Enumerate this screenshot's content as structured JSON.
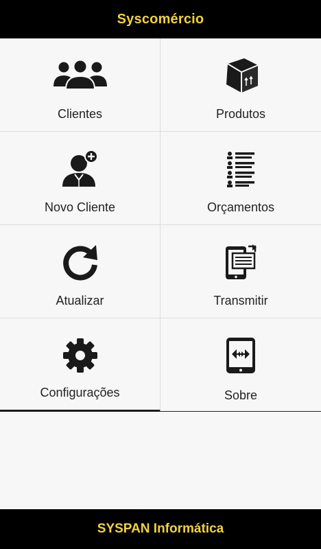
{
  "app": {
    "title": "Syscomércio"
  },
  "menu": [
    {
      "label": "Clientes",
      "icon": "clients-icon"
    },
    {
      "label": "Produtos",
      "icon": "product-box-icon"
    },
    {
      "label": "Novo Cliente",
      "icon": "add-client-icon"
    },
    {
      "label": "Orçamentos",
      "icon": "quotes-list-icon"
    },
    {
      "label": "Atualizar",
      "icon": "refresh-icon"
    },
    {
      "label": "Transmitir",
      "icon": "transmit-tablet-icon"
    },
    {
      "label": "Configurações",
      "icon": "gear-icon"
    },
    {
      "label": "Sobre",
      "icon": "about-tablet-icon"
    }
  ],
  "footer": {
    "text": "SYSPAN Informática"
  },
  "colors": {
    "accent": "#f2d23c",
    "bar_background": "#000000",
    "tile_background": "#f7f7f7"
  }
}
